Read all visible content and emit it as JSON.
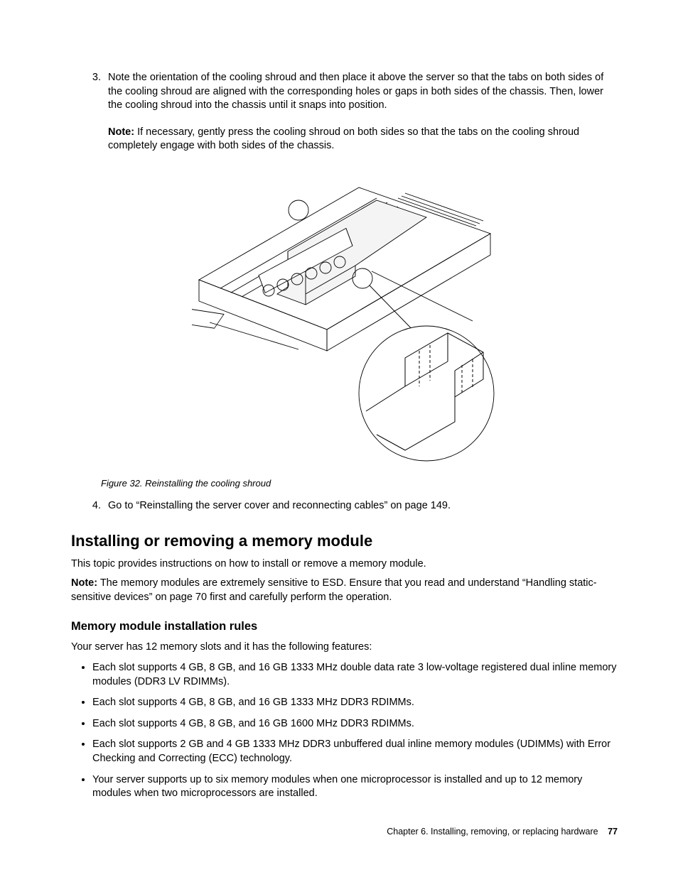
{
  "step3": {
    "marker": "3.",
    "text": "Note the orientation of the cooling shroud and then place it above the server so that the tabs on both sides of the cooling shroud are aligned with the corresponding holes or gaps in both sides of the chassis. Then, lower the cooling shroud into the chassis until it snaps into position.",
    "note_label": "Note:",
    "note_text": " If necessary, gently press the cooling shroud on both sides so that the tabs on the cooling shroud completely engage with both sides of the chassis."
  },
  "figure": {
    "caption": "Figure 32.  Reinstalling the cooling shroud"
  },
  "step4": {
    "marker": "4.",
    "text": "Go to “Reinstalling the server cover and reconnecting cables” on page 149."
  },
  "section": {
    "title": "Installing or removing a memory module",
    "intro": "This topic provides instructions on how to install or remove a memory module.",
    "note_label": "Note:",
    "note_text": " The memory modules are extremely sensitive to ESD. Ensure that you read and understand “Handling static-sensitive devices” on page 70 first and carefully perform the operation."
  },
  "subsection": {
    "title": "Memory module installation rules",
    "intro": "Your server has 12 memory slots and it has the following features:",
    "bullets": [
      "Each slot supports 4 GB, 8 GB, and 16 GB 1333 MHz double data rate 3 low-voltage registered dual inline memory modules (DDR3 LV RDIMMs).",
      "Each slot supports 4 GB, 8 GB, and 16 GB 1333 MHz DDR3 RDIMMs.",
      "Each slot supports 4 GB, 8 GB, and 16 GB 1600 MHz DDR3 RDIMMs.",
      "Each slot supports 2 GB and 4 GB 1333 MHz DDR3 unbuffered dual inline memory modules (UDIMMs) with Error Checking and Correcting (ECC) technology.",
      "Your server supports up to six memory modules when one microprocessor is installed and up to 12 memory modules when two microprocessors are installed."
    ]
  },
  "footer": {
    "chapter": "Chapter 6.  Installing, removing, or replacing hardware",
    "page": "77"
  }
}
